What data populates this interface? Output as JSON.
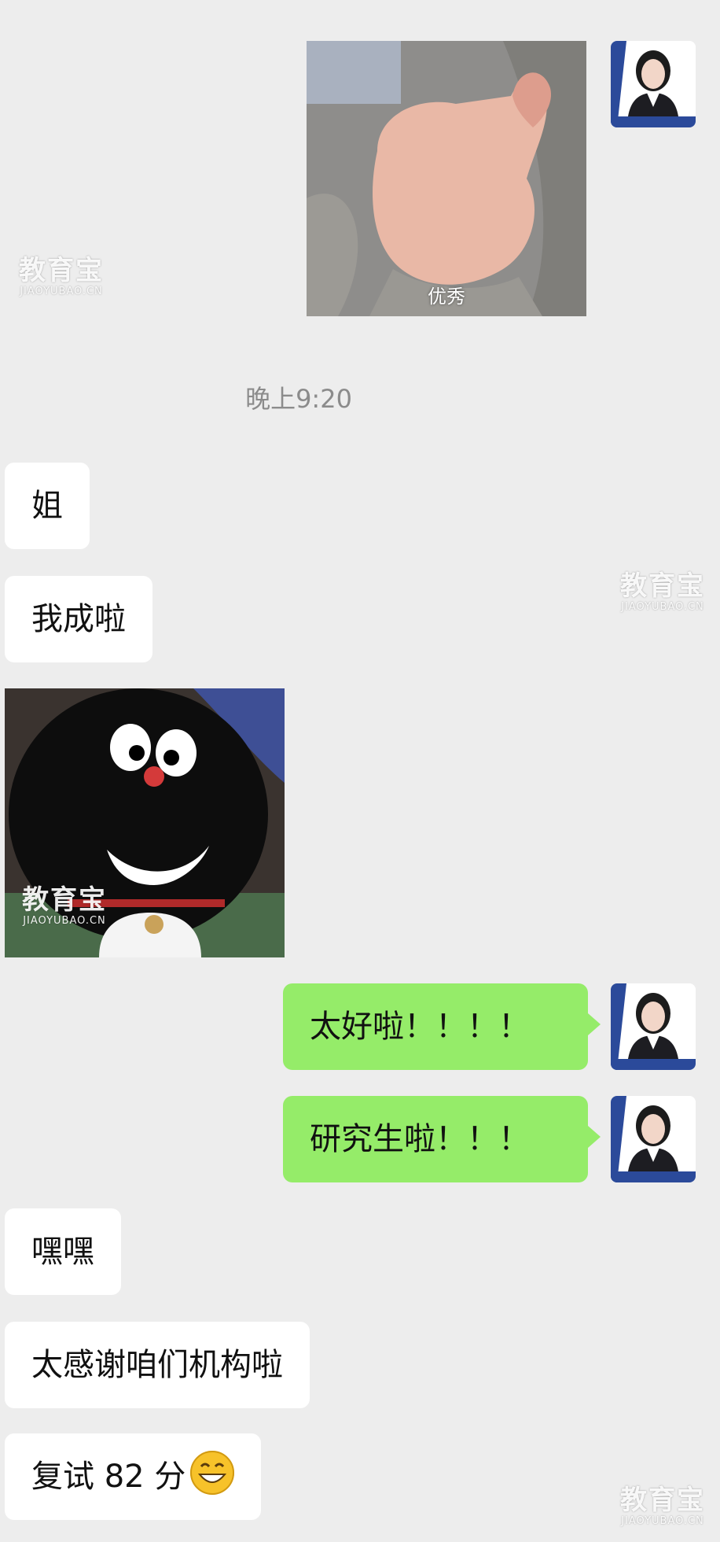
{
  "chat": {
    "image_caption": "优秀",
    "timestamp": "晚上9:20",
    "msg_jie": "姐",
    "msg_chenggong": "我成啦",
    "msg_taihaola": "太好啦！！！！",
    "msg_yanjiusheng": "研究生啦！！！",
    "msg_heihei": "嘿嘿",
    "msg_thanks": "太感谢咱们机构啦",
    "msg_score": "复试 82 分",
    "score_emoji": "grinning-face-emoji"
  },
  "watermark": {
    "brand": "教育宝",
    "url": "JIAOYUBAO.CN"
  },
  "colors": {
    "background": "#ededed",
    "incoming_bubble": "#ffffff",
    "outgoing_bubble": "#95ec69",
    "timestamp_text": "#8b8b8b",
    "avatar_frame": "#2b4a9a"
  }
}
